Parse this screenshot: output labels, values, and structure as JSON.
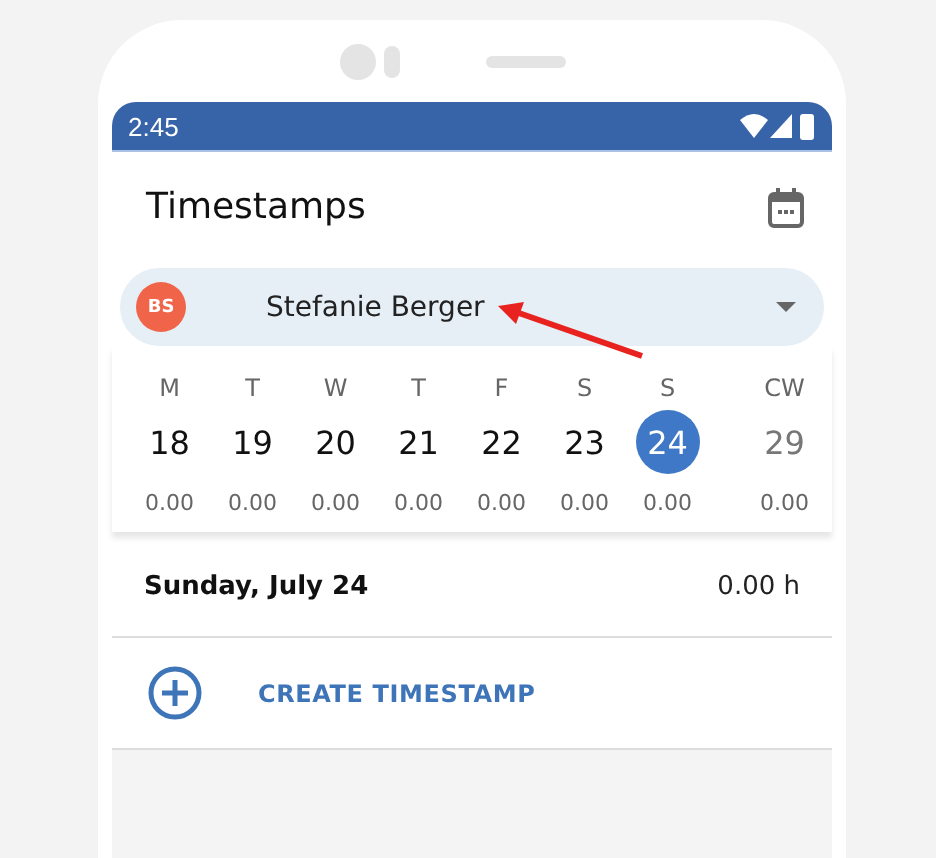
{
  "status_bar": {
    "time": "2:45"
  },
  "app_bar": {
    "title": "Timestamps"
  },
  "employee_selector": {
    "initials": "BS",
    "name": "Stefanie Berger"
  },
  "week": {
    "days": [
      {
        "weekday": "M",
        "date": "18",
        "hours": "0.00",
        "selected": false
      },
      {
        "weekday": "T",
        "date": "19",
        "hours": "0.00",
        "selected": false
      },
      {
        "weekday": "W",
        "date": "20",
        "hours": "0.00",
        "selected": false
      },
      {
        "weekday": "T",
        "date": "21",
        "hours": "0.00",
        "selected": false
      },
      {
        "weekday": "F",
        "date": "22",
        "hours": "0.00",
        "selected": false
      },
      {
        "weekday": "S",
        "date": "23",
        "hours": "0.00",
        "selected": false
      },
      {
        "weekday": "S",
        "date": "24",
        "hours": "0.00",
        "selected": true
      }
    ],
    "calendar_week": {
      "label": "CW",
      "value": "29",
      "hours": "0.00"
    }
  },
  "day_summary": {
    "date": "Sunday, July 24",
    "total": "0.00 h"
  },
  "create_button": {
    "label": "CREATE TIMESTAMP"
  }
}
